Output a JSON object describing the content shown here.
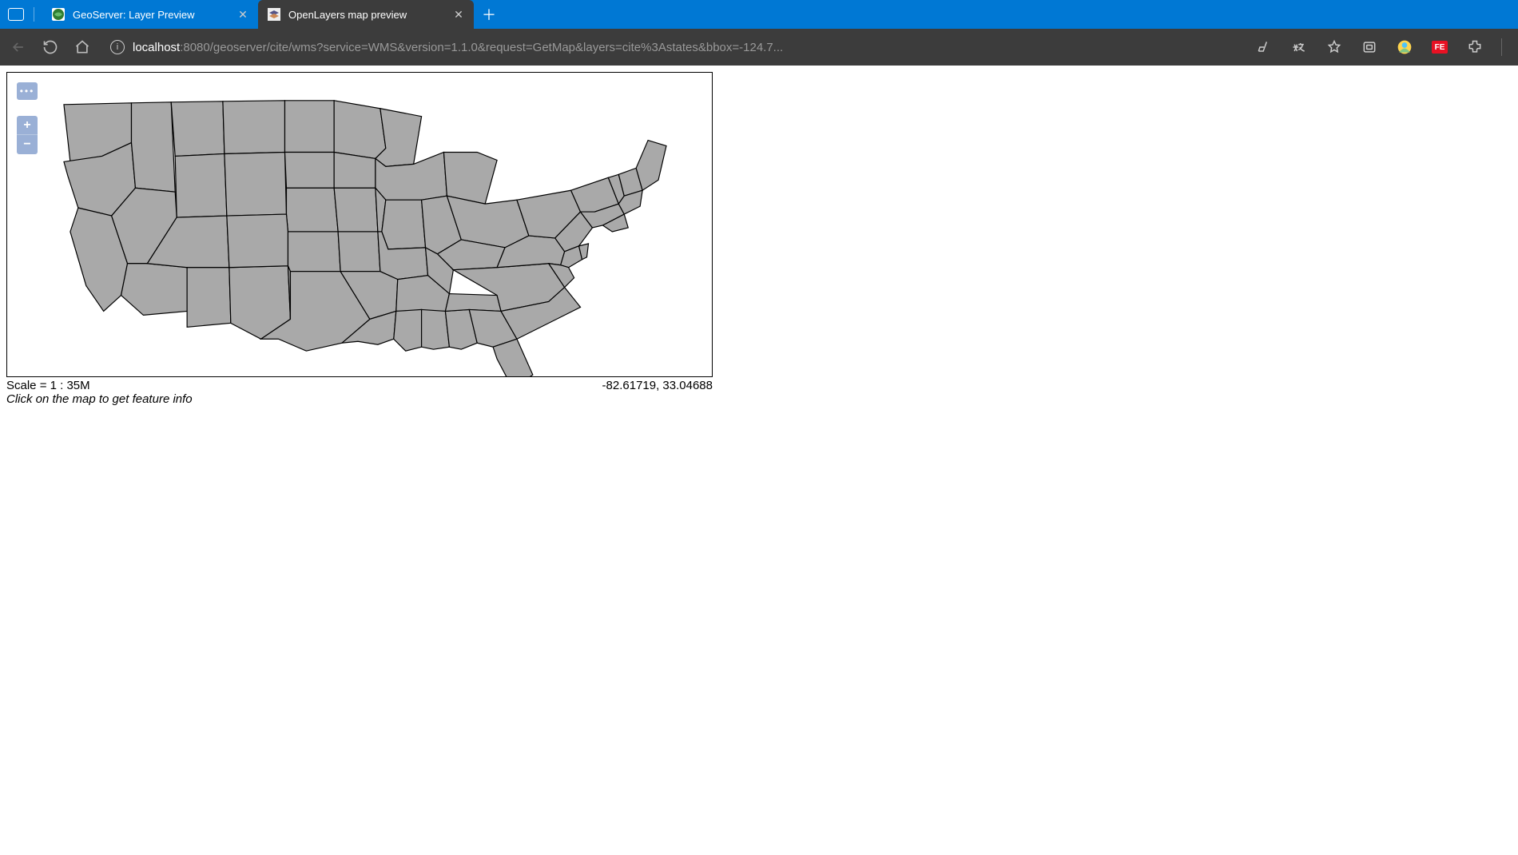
{
  "browser": {
    "tabs": [
      {
        "title": "GeoServer: Layer Preview",
        "active": false
      },
      {
        "title": "OpenLayers map preview",
        "active": true
      }
    ],
    "url_host": "localhost",
    "url_rest": ":8080/geoserver/cite/wms?service=WMS&version=1.1.0&request=GetMap&layers=cite%3Astates&bbox=-124.7..."
  },
  "map": {
    "scale_label": "Scale = 1 : 35M",
    "coords": "-82.61719, 33.04688",
    "hint": "Click on the map to get feature info",
    "zoom_in": "+",
    "zoom_out": "−",
    "options": "•••"
  }
}
